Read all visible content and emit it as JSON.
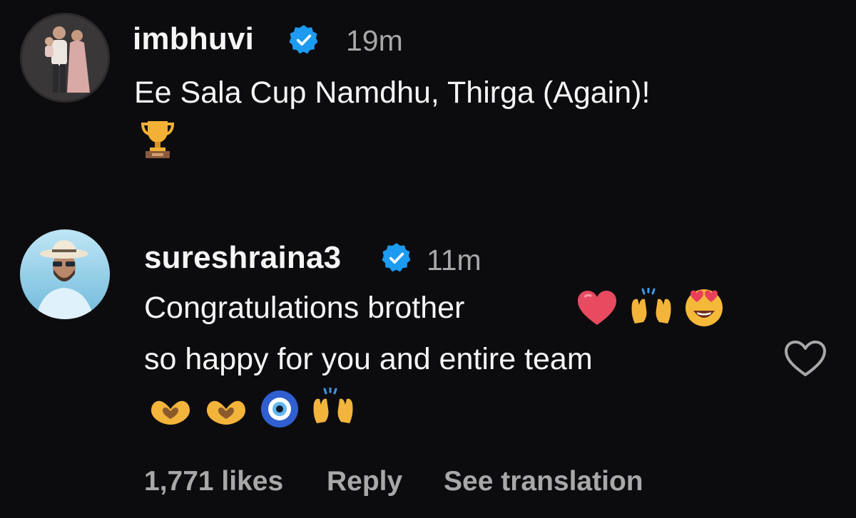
{
  "comments": [
    {
      "username": "imbhuvi",
      "verified": true,
      "time": "19m",
      "text": "Ee Sala Cup Namdhu, Thirga (Again)!",
      "emojis": [
        "trophy-emoji"
      ]
    },
    {
      "username": "sureshraina3",
      "verified": true,
      "time": "11m",
      "line1": "Congratulations brother",
      "line1_emojis": [
        "red-heart-emoji",
        "raising-hands-emoji",
        "smiling-face-heart-eyes-emoji"
      ],
      "line2": "so happy for you and entire team",
      "line3_emojis": [
        "heart-hands-emoji",
        "heart-hands-emoji",
        "nazar-amulet-emoji",
        "raising-hands-emoji"
      ],
      "likes": "1,771 likes",
      "reply": "Reply",
      "see_translation": "See translation",
      "like_icon": "heart-outline-icon"
    }
  ],
  "colors": {
    "background": "#0c0c0f",
    "text": "#f5f5f5",
    "muted": "#a8a8a8",
    "verified": "#1d9bf0"
  }
}
